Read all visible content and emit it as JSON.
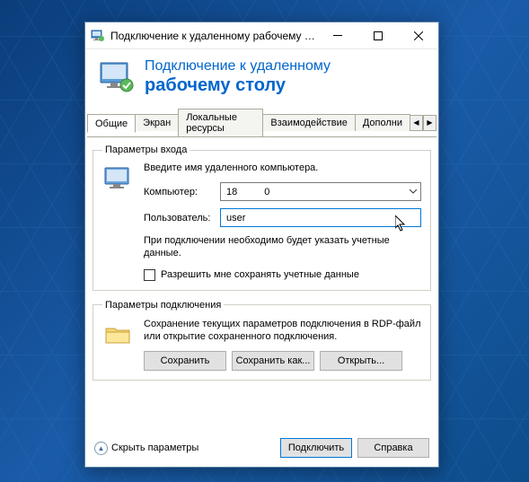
{
  "titlebar": {
    "title": "Подключение к удаленному рабочему с..."
  },
  "header": {
    "line1": "Подключение к удаленному",
    "line2": "рабочему столу"
  },
  "tabs": {
    "items": [
      "Общие",
      "Экран",
      "Локальные ресурсы",
      "Взаимодействие",
      "Дополни"
    ],
    "active_index": 0
  },
  "login_group": {
    "legend": "Параметры входа",
    "instruction": "Введите имя удаленного компьютера.",
    "computer_label": "Компьютер:",
    "computer_value_prefix": "18",
    "computer_value_suffix": "0",
    "user_label": "Пользователь:",
    "user_value": "user",
    "note": "При подключении необходимо будет указать учетные данные.",
    "allow_save_label": "Разрешить мне сохранять учетные данные"
  },
  "conn_group": {
    "legend": "Параметры подключения",
    "text": "Сохранение текущих параметров подключения в RDP-файл или открытие сохраненного подключения.",
    "save_label": "Сохранить",
    "save_as_label": "Сохранить как...",
    "open_label": "Открыть..."
  },
  "footer": {
    "hide_label": "Скрыть параметры",
    "connect_label": "Подключить",
    "help_label": "Справка"
  }
}
